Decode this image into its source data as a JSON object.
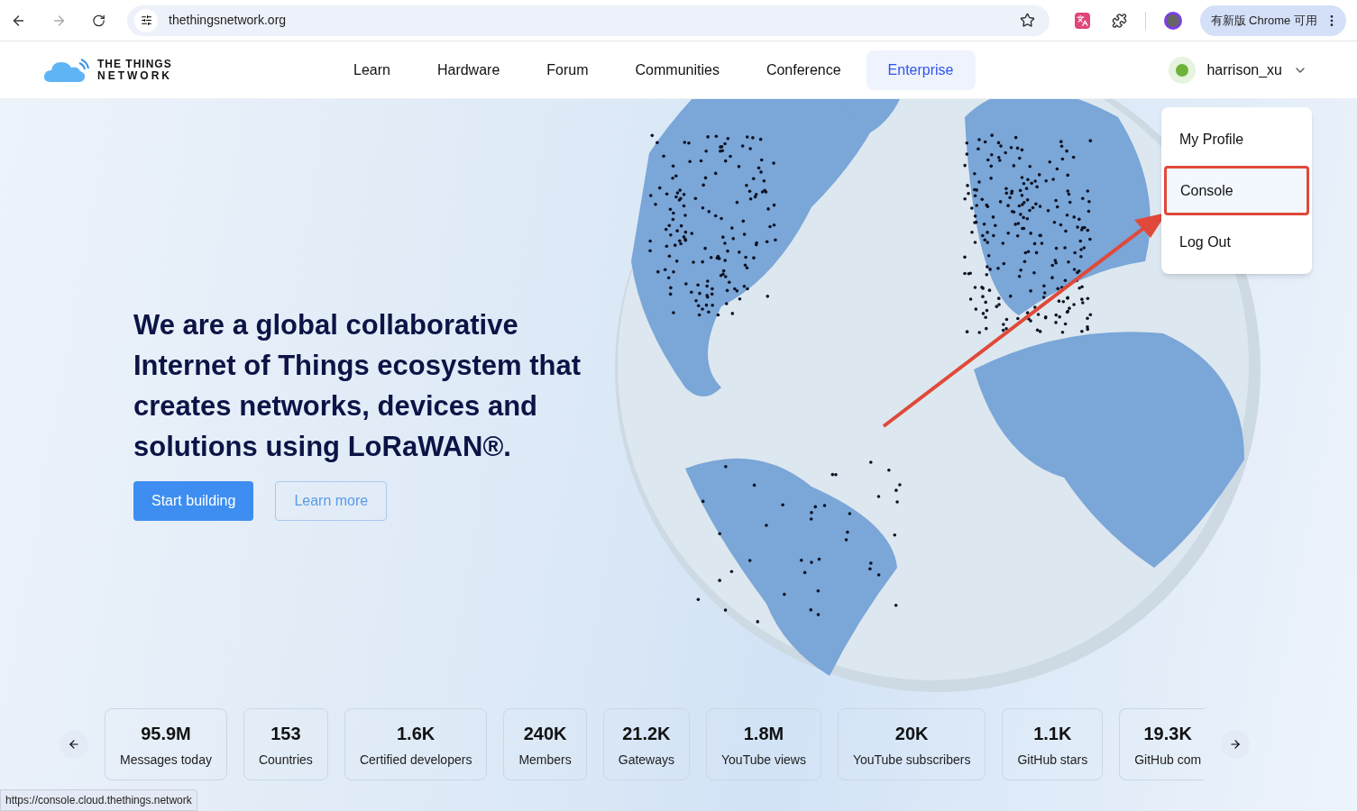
{
  "browser": {
    "url": "thethingsnetwork.org",
    "update_button": "有新版 Chrome 可用",
    "status_url": "https://console.cloud.thethings.network"
  },
  "header": {
    "logo_line1": "THE THINGS",
    "logo_line2": "NETWORK",
    "nav": [
      {
        "label": "Learn",
        "highlighted": false
      },
      {
        "label": "Hardware",
        "highlighted": false
      },
      {
        "label": "Forum",
        "highlighted": false
      },
      {
        "label": "Communities",
        "highlighted": false
      },
      {
        "label": "Conference",
        "highlighted": false
      },
      {
        "label": "Enterprise",
        "highlighted": true
      }
    ],
    "user": {
      "name": "harrison_xu",
      "menu_open": true
    }
  },
  "user_menu": [
    {
      "label": "My Profile",
      "hovered": false,
      "annotated": false
    },
    {
      "label": "Console",
      "hovered": true,
      "annotated": true
    },
    {
      "label": "Log Out",
      "hovered": false,
      "annotated": false
    }
  ],
  "hero": {
    "headline": "We are a global collaborative Internet of Things ecosystem that creates networks, devices and solutions using LoRaWAN®.",
    "primary_button": "Start building",
    "secondary_button": "Learn more"
  },
  "stats": [
    {
      "value": "95.9M",
      "label": "Messages today"
    },
    {
      "value": "153",
      "label": "Countries"
    },
    {
      "value": "1.6K",
      "label": "Certified developers"
    },
    {
      "value": "240K",
      "label": "Members"
    },
    {
      "value": "21.2K",
      "label": "Gateways"
    },
    {
      "value": "1.8M",
      "label": "YouTube views"
    },
    {
      "value": "20K",
      "label": "YouTube subscribers"
    },
    {
      "value": "1.1K",
      "label": "GitHub stars"
    },
    {
      "value": "19.3K",
      "label": "GitHub com"
    }
  ]
}
